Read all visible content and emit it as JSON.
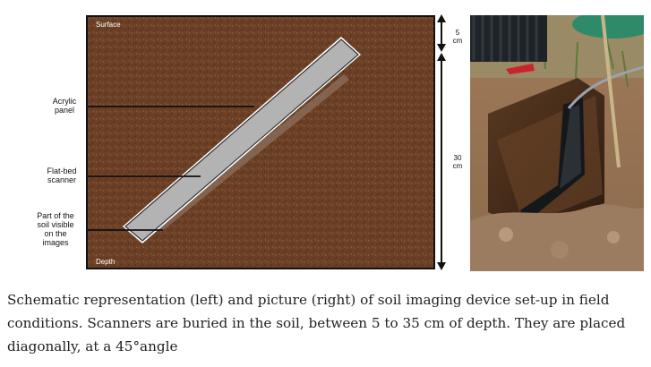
{
  "schematic": {
    "surface_label": "Surface",
    "depth_label": "Depth",
    "labels": {
      "acrylic_panel": [
        "Acrylic",
        "panel"
      ],
      "flatbed_scanner": [
        "Flat-bed",
        "scanner"
      ],
      "soil_visible": [
        "Part of the",
        "soil visible",
        "on the",
        "images"
      ]
    },
    "scale": {
      "top": [
        "5",
        "cm"
      ],
      "bottom": [
        "30",
        "cm"
      ]
    }
  },
  "caption": {
    "text": "Schematic representation (left) and picture (right) of soil imaging device set-up in field conditions. Scanners are buried in the soil, between 5 to 35 cm of depth. They are placed diagonally, at a 45°angle"
  },
  "colors": {
    "soil": "#6b4026",
    "scanner_fill": "#b3b3b3",
    "text": "#222222"
  }
}
